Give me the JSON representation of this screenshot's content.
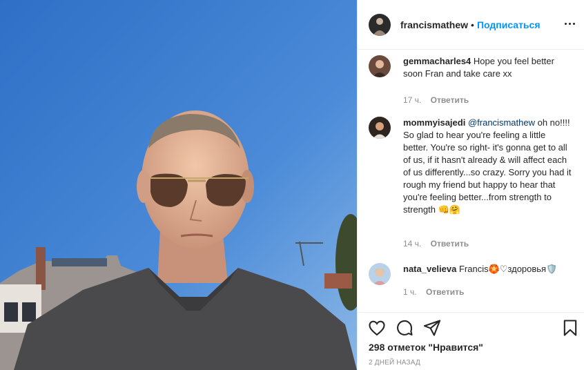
{
  "post": {
    "author": "francismathew",
    "separator": "•",
    "follow_label": "Подписаться",
    "likes_text": "298 отметок \"Нравится\"",
    "date_text": "2 ДНЕЙ НАЗАД"
  },
  "comments": [
    {
      "user": "gemmacharles4",
      "text": "Hope you feel better soon Fran and take care xx",
      "time": "17 ч.",
      "reply_label": "Ответить"
    },
    {
      "user": "mommyisajedi",
      "mention": "@francismathew",
      "text": "oh no!!!! So glad to hear you're feeling a little better. You're so right- it's gonna get to all of us, if it hasn't already & will affect each of us differently...so crazy. Sorry you had it rough my friend but happy to hear that you're feeling better...from strength to strength 👊🤗",
      "time": "14 ч.",
      "reply_label": "Ответить"
    },
    {
      "user": "nata_velieva",
      "text": "Francis🏵️♡здоровья🛡️",
      "time": "1 ч.",
      "reply_label": "Ответить"
    }
  ],
  "icons": {
    "like": "heart-icon",
    "comment": "comment-bubble-icon",
    "share": "paper-plane-icon",
    "save": "bookmark-icon",
    "more": "more-dots-icon"
  },
  "colors": {
    "link_blue": "#0095f6",
    "mention_blue": "#00376b",
    "muted_gray": "#8e8e8e",
    "divider": "#efefef",
    "sky": "#3f7fd0"
  }
}
